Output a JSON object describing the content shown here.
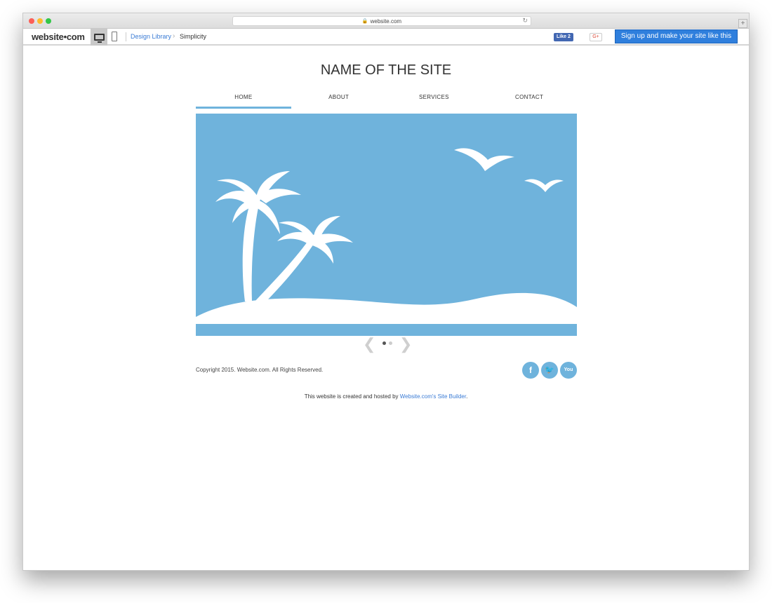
{
  "browser": {
    "url": "website.com"
  },
  "topbar": {
    "logo": "website•com",
    "breadcrumb_link": "Design Library",
    "breadcrumb_current": "Simplicity",
    "fb_like": "Like 2",
    "gplus": "G+",
    "signup_label": "Sign up and make your site like this"
  },
  "site": {
    "title": "NAME OF THE SITE",
    "nav": [
      "HOME",
      "ABOUT",
      "SERVICES",
      "CONTACT"
    ],
    "active_nav": "HOME",
    "accent_color": "#6fb3dc",
    "slideshow": {
      "slides": 2,
      "current": 1
    },
    "copyright": "Copyright 2015. Website.com. All Rights Reserved.",
    "social": {
      "facebook": "f",
      "twitter": "🐦",
      "youtube": "You Tube"
    }
  },
  "footer": {
    "prefix": "This website is created and hosted by ",
    "link": "Website.com's Site Builder",
    "suffix": "."
  }
}
